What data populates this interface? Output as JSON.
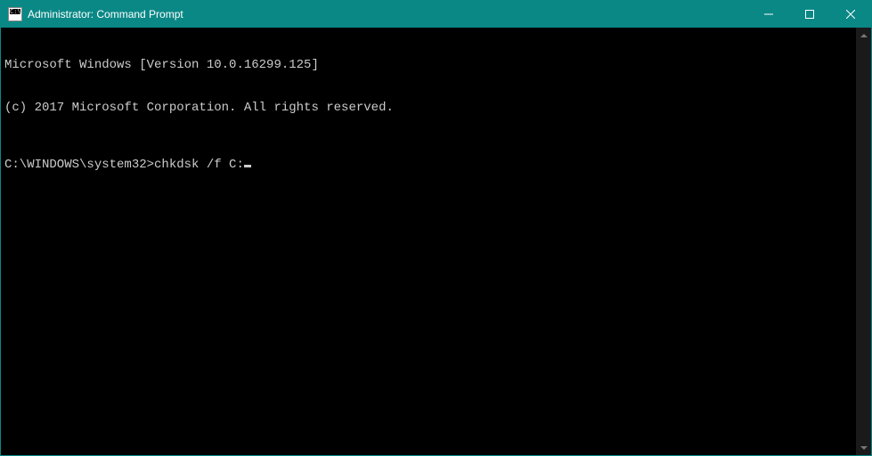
{
  "window": {
    "title": "Administrator: Command Prompt"
  },
  "terminal": {
    "line1": "Microsoft Windows [Version 10.0.16299.125]",
    "line2": "(c) 2017 Microsoft Corporation. All rights reserved.",
    "prompt": "C:\\WINDOWS\\system32>",
    "command": "chkdsk /f C:"
  }
}
